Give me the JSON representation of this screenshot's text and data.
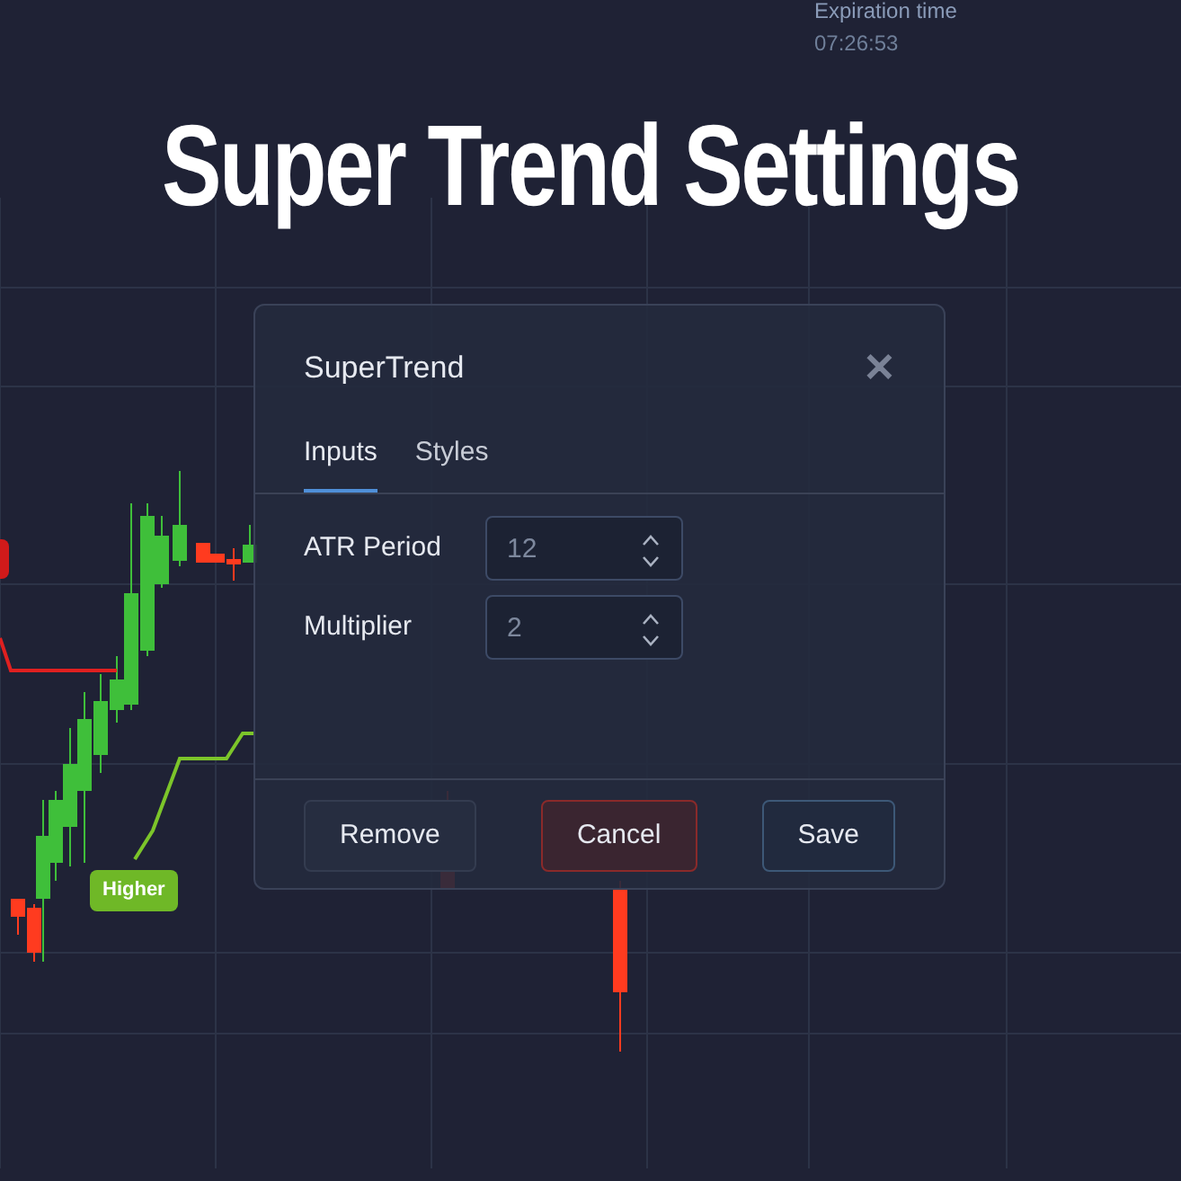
{
  "heading": "Super Trend Settings",
  "expiration": {
    "label": "Expiration time",
    "value": "07:26:53"
  },
  "chart_badges": [
    {
      "text": "Higher",
      "kind": "up"
    }
  ],
  "dialog": {
    "title": "SuperTrend",
    "close": "✕",
    "tabs": [
      {
        "label": "Inputs",
        "selected": true
      },
      {
        "label": "Styles",
        "selected": false
      }
    ],
    "fields": [
      {
        "label": "ATR Period",
        "value": "12"
      },
      {
        "label": "Multiplier",
        "value": "2"
      }
    ],
    "buttons": [
      {
        "label": "Remove",
        "kind": "default"
      },
      {
        "label": "Cancel",
        "kind": "danger"
      },
      {
        "label": "Save",
        "kind": "primary"
      }
    ]
  }
}
